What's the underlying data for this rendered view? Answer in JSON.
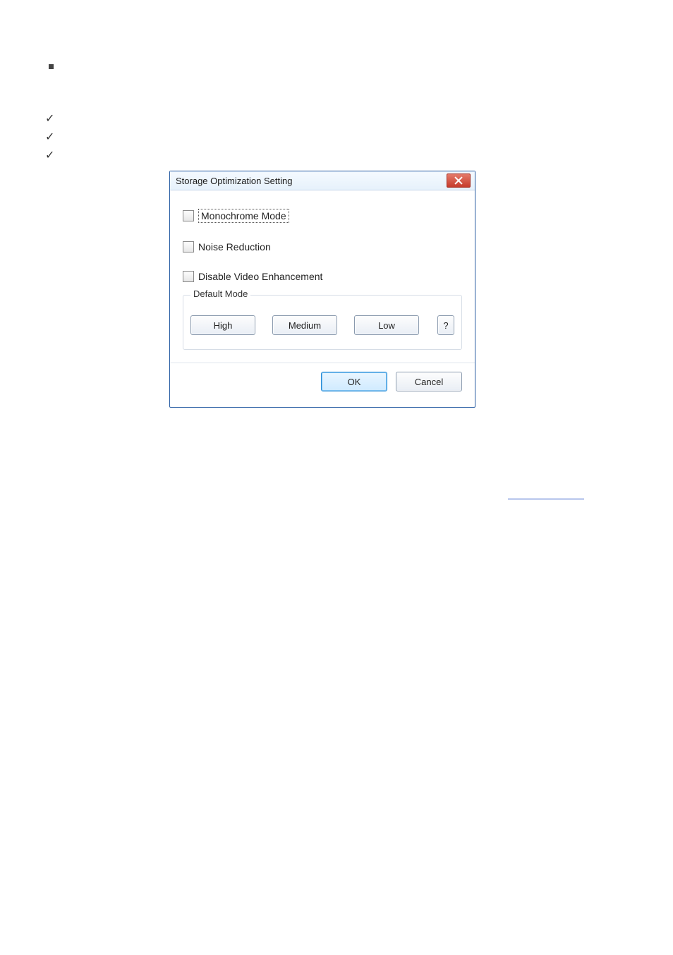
{
  "dialog": {
    "title": "Storage Optimization Setting",
    "checkbox_monochrome": "Monochrome Mode",
    "checkbox_noise": "Noise Reduction",
    "checkbox_disable_enh": "Disable Video Enhancement",
    "fieldset_legend": "Default Mode",
    "btn_high": "High",
    "btn_medium": "Medium",
    "btn_low": "Low",
    "btn_help": "?",
    "btn_ok": "OK",
    "btn_cancel": "Cancel"
  }
}
